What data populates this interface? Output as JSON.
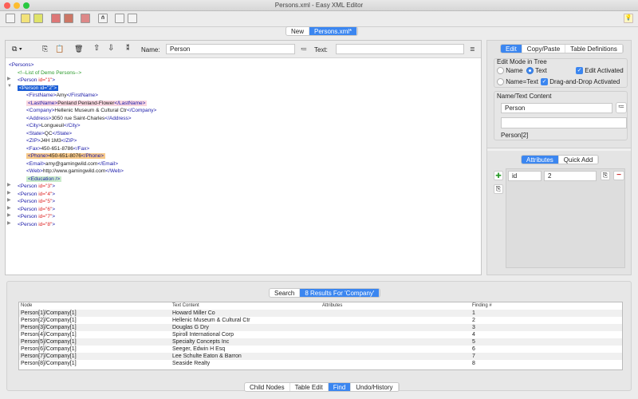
{
  "window": {
    "title": "Persons.xml - Easy XML Editor"
  },
  "doc_tabs": [
    "New",
    "Persons.xml*"
  ],
  "editor_toolbar": {
    "name_label": "Name:",
    "name_value": "Person",
    "text_label": "Text:",
    "text_value": ""
  },
  "tree": [
    {
      "indent": 0,
      "parts": [
        [
          "tag",
          "<Persons>"
        ]
      ]
    },
    {
      "indent": 1,
      "parts": [
        [
          "comment",
          "<!--List of Demo Persons-->"
        ]
      ]
    },
    {
      "indent": 1,
      "arrow": "▶",
      "parts": [
        [
          "tag",
          "<Person "
        ],
        [
          "attr",
          "id=\"1\""
        ],
        [
          "tag",
          ">"
        ]
      ]
    },
    {
      "indent": 1,
      "arrow": "▼",
      "selected": true,
      "parts": [
        [
          "tag",
          "<Person id=\"2\">"
        ]
      ]
    },
    {
      "indent": 2,
      "parts": [
        [
          "tag",
          "<FirstName>"
        ],
        [
          "txt",
          "Amy"
        ],
        [
          "tag",
          "</FirstName>"
        ]
      ]
    },
    {
      "indent": 2,
      "hl": "#f9d6e0",
      "parts": [
        [
          "tag",
          "<LastName>"
        ],
        [
          "txt",
          "Penland Penland-Flower"
        ],
        [
          "tag",
          "</LastName>"
        ]
      ]
    },
    {
      "indent": 2,
      "parts": [
        [
          "tag",
          "<Company>"
        ],
        [
          "txt",
          "Hellenic Museum & Cultural Ctr"
        ],
        [
          "tag",
          "</Company>"
        ]
      ]
    },
    {
      "indent": 2,
      "parts": [
        [
          "tag",
          "<Address>"
        ],
        [
          "txt",
          "3050 rue Saint-Charles"
        ],
        [
          "tag",
          "</Address>"
        ]
      ]
    },
    {
      "indent": 2,
      "parts": [
        [
          "tag",
          "<City>"
        ],
        [
          "txt",
          "Longueuil"
        ],
        [
          "tag",
          "</City>"
        ]
      ]
    },
    {
      "indent": 2,
      "parts": [
        [
          "tag",
          "<State>"
        ],
        [
          "txt",
          "QC"
        ],
        [
          "tag",
          "</State>"
        ]
      ]
    },
    {
      "indent": 2,
      "parts": [
        [
          "tag",
          "<ZIP>"
        ],
        [
          "txt",
          "J4H 1M3"
        ],
        [
          "tag",
          "</ZIP>"
        ]
      ]
    },
    {
      "indent": 2,
      "parts": [
        [
          "tag",
          "<Fax>"
        ],
        [
          "txt",
          "450-651-8786"
        ],
        [
          "tag",
          "</Fax>"
        ]
      ]
    },
    {
      "indent": 2,
      "hl": "#f7c98a",
      "parts": [
        [
          "tag",
          "<Phone>"
        ],
        [
          "txt",
          "450-651-8076"
        ],
        [
          "tag",
          "</Phone>"
        ]
      ]
    },
    {
      "indent": 2,
      "parts": [
        [
          "tag",
          "<Email>"
        ],
        [
          "txt",
          "amy@gamingwild.com"
        ],
        [
          "tag",
          "</Email>"
        ]
      ]
    },
    {
      "indent": 2,
      "parts": [
        [
          "tag",
          "<Web>"
        ],
        [
          "txt",
          "http://www.gamingwild.com"
        ],
        [
          "tag",
          "</Web>"
        ]
      ]
    },
    {
      "indent": 2,
      "hl": "#c9eccb",
      "parts": [
        [
          "tag",
          "<Education />"
        ]
      ]
    },
    {
      "indent": 1,
      "arrow": "▶",
      "parts": [
        [
          "tag",
          "<Person "
        ],
        [
          "attr",
          "id=\"3\""
        ],
        [
          "tag",
          ">"
        ]
      ]
    },
    {
      "indent": 1,
      "arrow": "▶",
      "parts": [
        [
          "tag",
          "<Person "
        ],
        [
          "attr",
          "id=\"4\""
        ],
        [
          "tag",
          ">"
        ]
      ]
    },
    {
      "indent": 1,
      "arrow": "▶",
      "parts": [
        [
          "tag",
          "<Person "
        ],
        [
          "attr",
          "id=\"5\""
        ],
        [
          "tag",
          ">"
        ]
      ]
    },
    {
      "indent": 1,
      "arrow": "▶",
      "parts": [
        [
          "tag",
          "<Person "
        ],
        [
          "attr",
          "id=\"6\""
        ],
        [
          "tag",
          ">"
        ]
      ]
    },
    {
      "indent": 1,
      "arrow": "▶",
      "parts": [
        [
          "tag",
          "<Person "
        ],
        [
          "attr",
          "id=\"7\""
        ],
        [
          "tag",
          ">"
        ]
      ]
    },
    {
      "indent": 1,
      "arrow": "▶",
      "parts": [
        [
          "tag",
          "<Person "
        ],
        [
          "attr",
          "id=\"8\""
        ],
        [
          "tag",
          ">"
        ]
      ]
    }
  ],
  "right_tabs": [
    "Edit",
    "Copy/Paste",
    "Table Definitions"
  ],
  "edit_mode": {
    "title": "Edit Mode in Tree",
    "name": "Name",
    "text": "Text",
    "name_eq_text": "Name=Text",
    "edit_activated": "Edit Activated",
    "dnd": "Drag-and-Drop Activated"
  },
  "content": {
    "title": "Name/Text Content",
    "name_value": "Person",
    "text_value": "",
    "path": "Person[2]"
  },
  "attr_tabs": [
    "Attributes",
    "Quick Add"
  ],
  "attributes": {
    "name": "id",
    "value": "2"
  },
  "find_tabs": [
    "Search",
    "8 Results For 'Company'"
  ],
  "results": {
    "headers": [
      "Node",
      "Text Content",
      "Attributes",
      "Finding #"
    ],
    "rows": [
      [
        "Person[1]/Company[1]",
        "Howard Miller Co",
        "",
        "1"
      ],
      [
        "Person[2]/Company[1]",
        "Hellenic Museum & Cultural Ctr",
        "",
        "2"
      ],
      [
        "Person[3]/Company[1]",
        "Douglas G Dry",
        "",
        "3"
      ],
      [
        "Person[4]/Company[1]",
        "Spiroll International Corp",
        "",
        "4"
      ],
      [
        "Person[5]/Company[1]",
        "Specialty Concepts Inc",
        "",
        "5"
      ],
      [
        "Person[6]/Company[1]",
        "Seeger, Edwin H Esq",
        "",
        "6"
      ],
      [
        "Person[7]/Company[1]",
        "Lee Schulte Eaton & Barron",
        "",
        "7"
      ],
      [
        "Person[8]/Company[1]",
        "Seaside Realty",
        "",
        "8"
      ]
    ]
  },
  "bottom_tabs": [
    "Child Nodes",
    "Table Edit",
    "Find",
    "Undo/History"
  ]
}
